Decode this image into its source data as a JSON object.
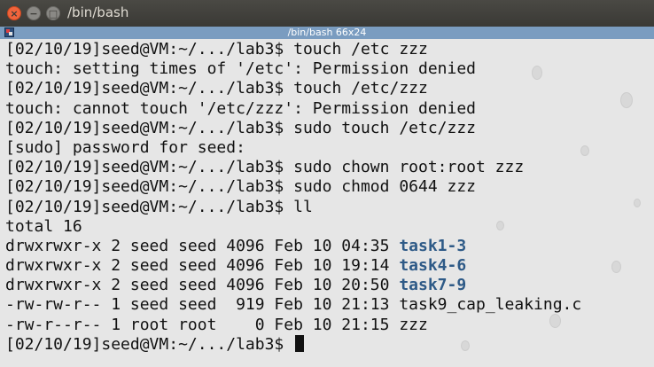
{
  "window": {
    "title": "/bin/bash",
    "close_glyph": "×",
    "minimize_glyph": "−",
    "maximize_glyph": "□"
  },
  "xterm": {
    "title": "/bin/bash 66x24",
    "menu_icon": "xterm-menu-icon"
  },
  "terminal": {
    "lines": [
      {
        "text": "[02/10/19]seed@VM:~/.../lab3$ touch /etc zzz"
      },
      {
        "text": "touch: setting times of '/etc': Permission denied"
      },
      {
        "text": "[02/10/19]seed@VM:~/.../lab3$ touch /etc/zzz"
      },
      {
        "text": "touch: cannot touch '/etc/zzz': Permission denied"
      },
      {
        "text": "[02/10/19]seed@VM:~/.../lab3$ sudo touch /etc/zzz"
      },
      {
        "text": "[sudo] password for seed:"
      },
      {
        "text": "[02/10/19]seed@VM:~/.../lab3$ sudo chown root:root zzz"
      },
      {
        "text": "[02/10/19]seed@VM:~/.../lab3$ sudo chmod 0644 zzz"
      },
      {
        "text": "[02/10/19]seed@VM:~/.../lab3$ ll"
      },
      {
        "text": "total 16"
      },
      {
        "text": "drwxrwxr-x 2 seed seed 4096 Feb 10 04:35 ",
        "name": "task1-3",
        "is_dir": true
      },
      {
        "text": "drwxrwxr-x 2 seed seed 4096 Feb 10 19:14 ",
        "name": "task4-6",
        "is_dir": true
      },
      {
        "text": "drwxrwxr-x 2 seed seed 4096 Feb 10 20:50 ",
        "name": "task7-9",
        "is_dir": true
      },
      {
        "text": "-rw-rw-r-- 1 seed seed  919 Feb 10 21:13 ",
        "name": "task9_cap_leaking.c",
        "is_dir": false
      },
      {
        "text": "-rw-r--r-- 1 root root    0 Feb 10 21:15 ",
        "name": "zzz",
        "is_dir": false
      },
      {
        "text": "[02/10/19]seed@VM:~/.../lab3$ ",
        "cursor": true
      }
    ]
  },
  "colors": {
    "terminal_bg": "#e6e6e6",
    "text": "#111111",
    "directory": "#2e5a87",
    "xterm_bar": "#7a9cc0",
    "titlebar": "#3c3b37"
  }
}
